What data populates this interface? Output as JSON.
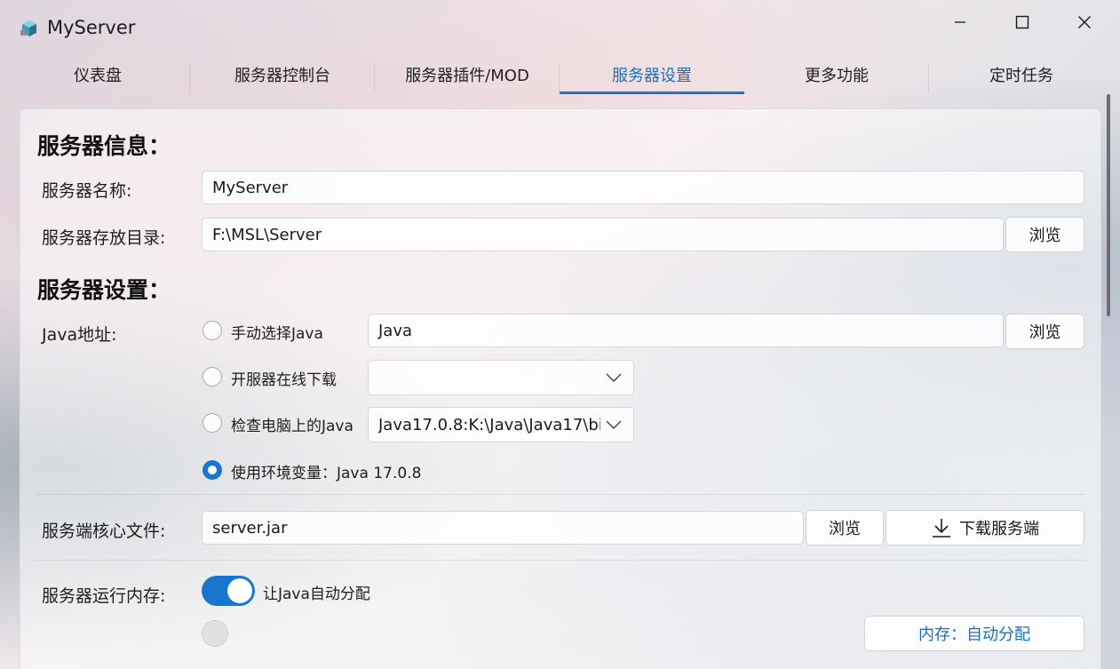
{
  "window": {
    "title": "MyServer",
    "app_icon": "cube-icon",
    "controls": [
      "minimize-icon",
      "maximize-icon",
      "close-icon"
    ]
  },
  "tabs": [
    {
      "label": "仪表盘",
      "active": false
    },
    {
      "label": "服务器控制台",
      "active": false
    },
    {
      "label": "服务器插件/MOD",
      "active": false
    },
    {
      "label": "服务器设置",
      "active": true
    },
    {
      "label": "更多功能",
      "active": false
    },
    {
      "label": "定时任务",
      "active": false
    }
  ],
  "accent_color": "#1976cf",
  "server_info": {
    "heading": "服务器信息：",
    "name_label": "服务器名称:",
    "name_value": "MyServer",
    "dir_label": "服务器存放目录:",
    "dir_value": "F:\\MSL\\Server",
    "browse_label": "浏览"
  },
  "server_settings": {
    "heading": "服务器设置：",
    "java_label": "Java地址:",
    "options": [
      {
        "label": "手动选择Java",
        "checked": false
      },
      {
        "label": "开服器在线下载",
        "checked": false
      },
      {
        "label": "检查电脑上的Java",
        "checked": false
      },
      {
        "label": "使用环境变量：Java 17.0.8",
        "checked": true
      }
    ],
    "manual_java_value": "Java",
    "manual_browse_label": "浏览",
    "online_download_value": "",
    "local_java_value": "Java17.0.8:K:\\Java\\Java17\\bi"
  },
  "core": {
    "label": "服务端核心文件:",
    "value": "server.jar",
    "browse_label": "浏览",
    "download_label": "下载服务端",
    "download_icon": "download-icon"
  },
  "memory": {
    "label": "服务器运行内存:",
    "toggle_label": "让Java自动分配",
    "toggle_on": true,
    "memory_button_label": "内存：自动分配"
  }
}
